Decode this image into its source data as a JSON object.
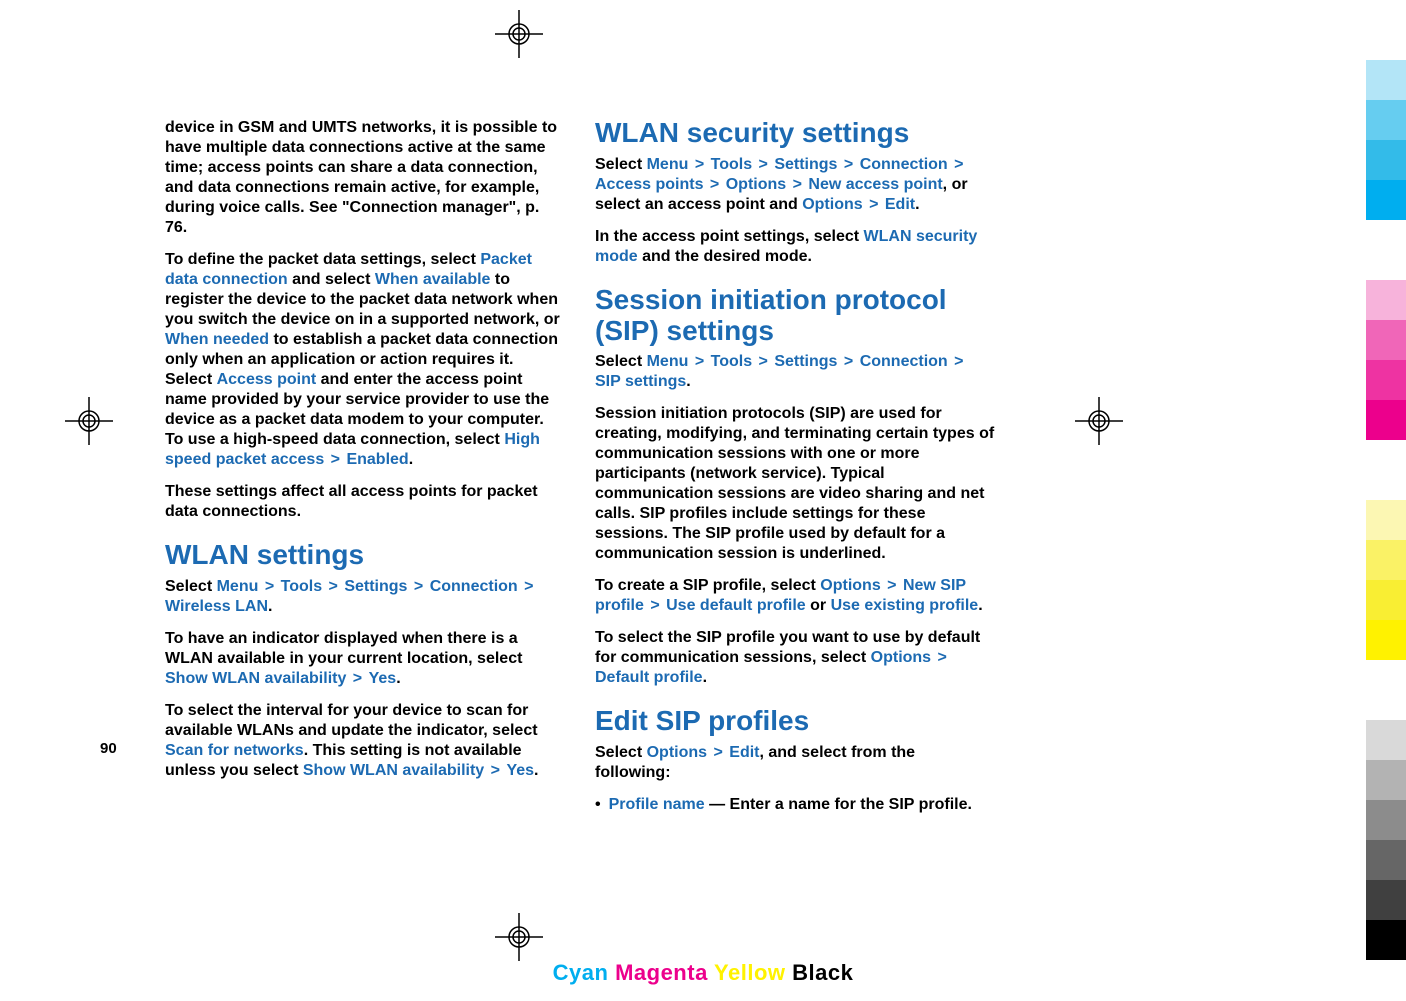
{
  "left_column": {
    "p1": "device in GSM and UMTS networks, it is possible to have multiple data connections active at the same time; access points can share a data connection, and data connections remain active, for example, during voice calls. See \"Connection manager\", p. 76.",
    "p2_a": "To define the packet data settings, select ",
    "p2_link1": "Packet data connection",
    "p2_b": " and select ",
    "p2_link2": "When available",
    "p2_c": " to register the device to the packet data network when you switch the device on in a supported network, or ",
    "p2_link3": "When needed",
    "p2_d": " to establish a packet data connection only when an application or action requires it. Select ",
    "p2_link4": "Access point",
    "p2_e": " and enter the access point name provided by your service provider to use the device as a packet data modem to your computer. To use a high-speed data connection, select ",
    "p2_link5": "High speed packet access",
    "p2_f": "",
    "p2_link6": "Enabled",
    "p2_g": ".",
    "p3": "These settings affect all access points for packet data connections.",
    "h_wlan": "WLAN settings",
    "p4_a": "Select ",
    "p4_menu": "Menu",
    "p4_tools": "Tools",
    "p4_settings": "Settings",
    "p4_connection": "Connection",
    "p4_wlan": "Wireless LAN",
    "p4_b": ".",
    "p5_a": "To have an indicator displayed when there is a WLAN available in your current location, select ",
    "p5_link1": "Show WLAN availability",
    "p5_link2": "Yes",
    "p5_b": ".",
    "p6_a": "To select the interval for your device to scan for available WLANs and update the indicator, select ",
    "p6_link1": "Scan for networks",
    "p6_b": ". This setting is not available unless you select ",
    "p6_link2": "Show WLAN availability",
    "p6_link3": "Yes",
    "p6_c": "."
  },
  "right_column": {
    "h_wlansec": "WLAN security settings",
    "ps1_a": "Select ",
    "ps1_menu": "Menu",
    "ps1_tools": "Tools",
    "ps1_settings": "Settings",
    "ps1_connection": "Connection",
    "ps1_ap": "Access points",
    "ps1_options": "Options",
    "ps1_nap": "New access point",
    "ps1_b": ", or select an access point and ",
    "ps1_options2": "Options",
    "ps1_edit": "Edit",
    "ps1_c": ".",
    "ps2_a": "In the access point settings, select ",
    "ps2_link": "WLAN security mode",
    "ps2_b": " and the desired mode.",
    "h_sip": "Session initiation protocol (SIP) settings",
    "ps3_a": "Select ",
    "ps3_menu": "Menu",
    "ps3_tools": "Tools",
    "ps3_settings": "Settings",
    "ps3_connection": "Connection",
    "ps3_sip": "SIP settings",
    "ps3_b": ".",
    "ps4": "Session initiation protocols (SIP) are used for creating, modifying, and terminating certain types of communication sessions with one or more participants (network service). Typical communication sessions are video sharing and net calls. SIP profiles include settings for these sessions. The SIP profile used by default for a communication session is underlined.",
    "ps5_a": "To create a SIP profile, select ",
    "ps5_options": "Options",
    "ps5_new": "New SIP profile",
    "ps5_usedef": "Use default profile",
    "ps5_or": " or ",
    "ps5_useex": "Use existing profile",
    "ps5_b": ".",
    "ps6_a": "To select the SIP profile you want to use by default for communication sessions, select ",
    "ps6_options": "Options",
    "ps6_def": "Default profile",
    "ps6_b": ".",
    "h_edit": "Edit SIP profiles",
    "ps7_a": "Select ",
    "ps7_options": "Options",
    "ps7_edit": "Edit",
    "ps7_b": ", and select from the following:",
    "bullet_link": "Profile name",
    "bullet_text": " — Enter a name for the SIP profile."
  },
  "gt": ">",
  "page_number": "90",
  "footer": {
    "cyan": "Cyan",
    "magenta": "Magenta",
    "yellow": "Yellow",
    "black": "Black"
  },
  "colors": {
    "cyan_bars": [
      "#b3e5f7",
      "#66cdf0",
      "#33bbe9",
      "#00aeef"
    ],
    "magenta_bars": [
      "#f7b3db",
      "#f066b8",
      "#ee33a2",
      "#ec008c"
    ],
    "yellow_bars": [
      "#fcf7b3",
      "#faf266",
      "#f9ee33",
      "#fff200"
    ],
    "gray_bars": [
      "#d9d9d9",
      "#b3b3b3",
      "#8c8c8c",
      "#666666",
      "#404040",
      "#000000"
    ]
  }
}
